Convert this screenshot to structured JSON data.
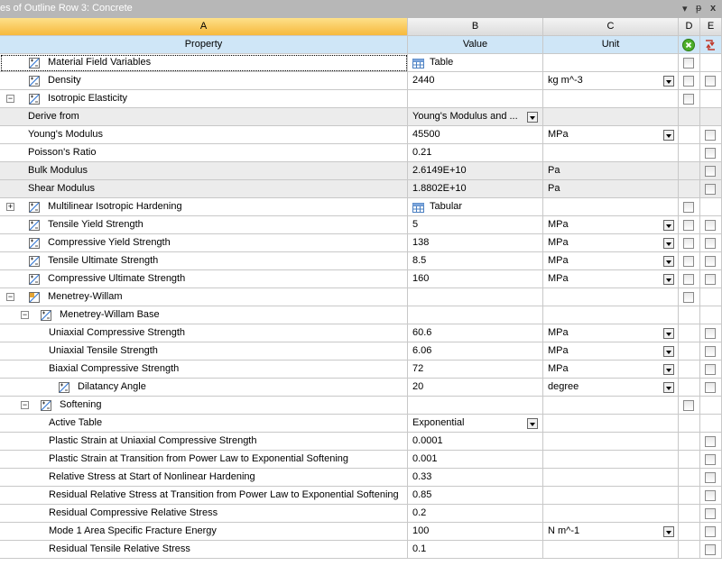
{
  "window": {
    "title": "es of Outline Row 3: Concrete",
    "controls": {
      "dropdown": "▾",
      "pin": "ᵽ",
      "close": "x"
    }
  },
  "columns": {
    "A": "A",
    "B": "B",
    "C": "C",
    "D": "D",
    "E": "E"
  },
  "header": {
    "property": "Property",
    "value": "Value",
    "unit": "Unit"
  },
  "rows": [
    {
      "label": "Material Field Variables",
      "value": "Table"
    },
    {
      "label": "Density",
      "value": "2440",
      "unit": "kg m^-3"
    },
    {
      "label": "Isotropic Elasticity"
    },
    {
      "label": "Derive from",
      "value": "Young's Modulus and ..."
    },
    {
      "label": "Young's Modulus",
      "value": "45500",
      "unit": "MPa"
    },
    {
      "label": "Poisson's Ratio",
      "value": "0.21"
    },
    {
      "label": "Bulk Modulus",
      "value": "2.6149E+10",
      "unit": "Pa"
    },
    {
      "label": "Shear Modulus",
      "value": "1.8802E+10",
      "unit": "Pa"
    },
    {
      "label": "Multilinear Isotropic Hardening",
      "value": "Tabular"
    },
    {
      "label": "Tensile Yield Strength",
      "value": "5",
      "unit": "MPa"
    },
    {
      "label": "Compressive Yield Strength",
      "value": "138",
      "unit": "MPa"
    },
    {
      "label": "Tensile Ultimate Strength",
      "value": "8.5",
      "unit": "MPa"
    },
    {
      "label": "Compressive Ultimate Strength",
      "value": "160",
      "unit": "MPa"
    },
    {
      "label": "Menetrey-Willam"
    },
    {
      "label": "Menetrey-Willam Base"
    },
    {
      "label": "Uniaxial Compressive Strength",
      "value": "60.6",
      "unit": "MPa"
    },
    {
      "label": "Uniaxial Tensile Strength",
      "value": "6.06",
      "unit": "MPa"
    },
    {
      "label": "Biaxial Compressive Strength",
      "value": "72",
      "unit": "MPa"
    },
    {
      "label": "Dilatancy Angle",
      "value": "20",
      "unit": "degree"
    },
    {
      "label": "Softening"
    },
    {
      "label": "Active Table",
      "value": "Exponential"
    },
    {
      "label": "Plastic Strain at Uniaxial Compressive Strength",
      "value": "0.0001"
    },
    {
      "label": "Plastic Strain at Transition from Power Law to Exponential Softening",
      "value": "0.001"
    },
    {
      "label": "Relative Stress at Start of Nonlinear Hardening",
      "value": "0.33"
    },
    {
      "label": "Residual Relative Stress at Transition from Power Law to Exponential Softening",
      "value": "0.85"
    },
    {
      "label": "Residual Compressive Relative Stress",
      "value": "0.2"
    },
    {
      "label": "Mode 1 Area Specific Fracture Energy",
      "value": "100",
      "unit": "N m^-1"
    },
    {
      "label": "Residual Tensile Relative Stress",
      "value": "0.1"
    }
  ],
  "colors": {
    "header_selected": "#f7b93c",
    "subheader": "#cfe6f7",
    "readonly_row": "#ececec",
    "grid": "#c8c8c8"
  }
}
